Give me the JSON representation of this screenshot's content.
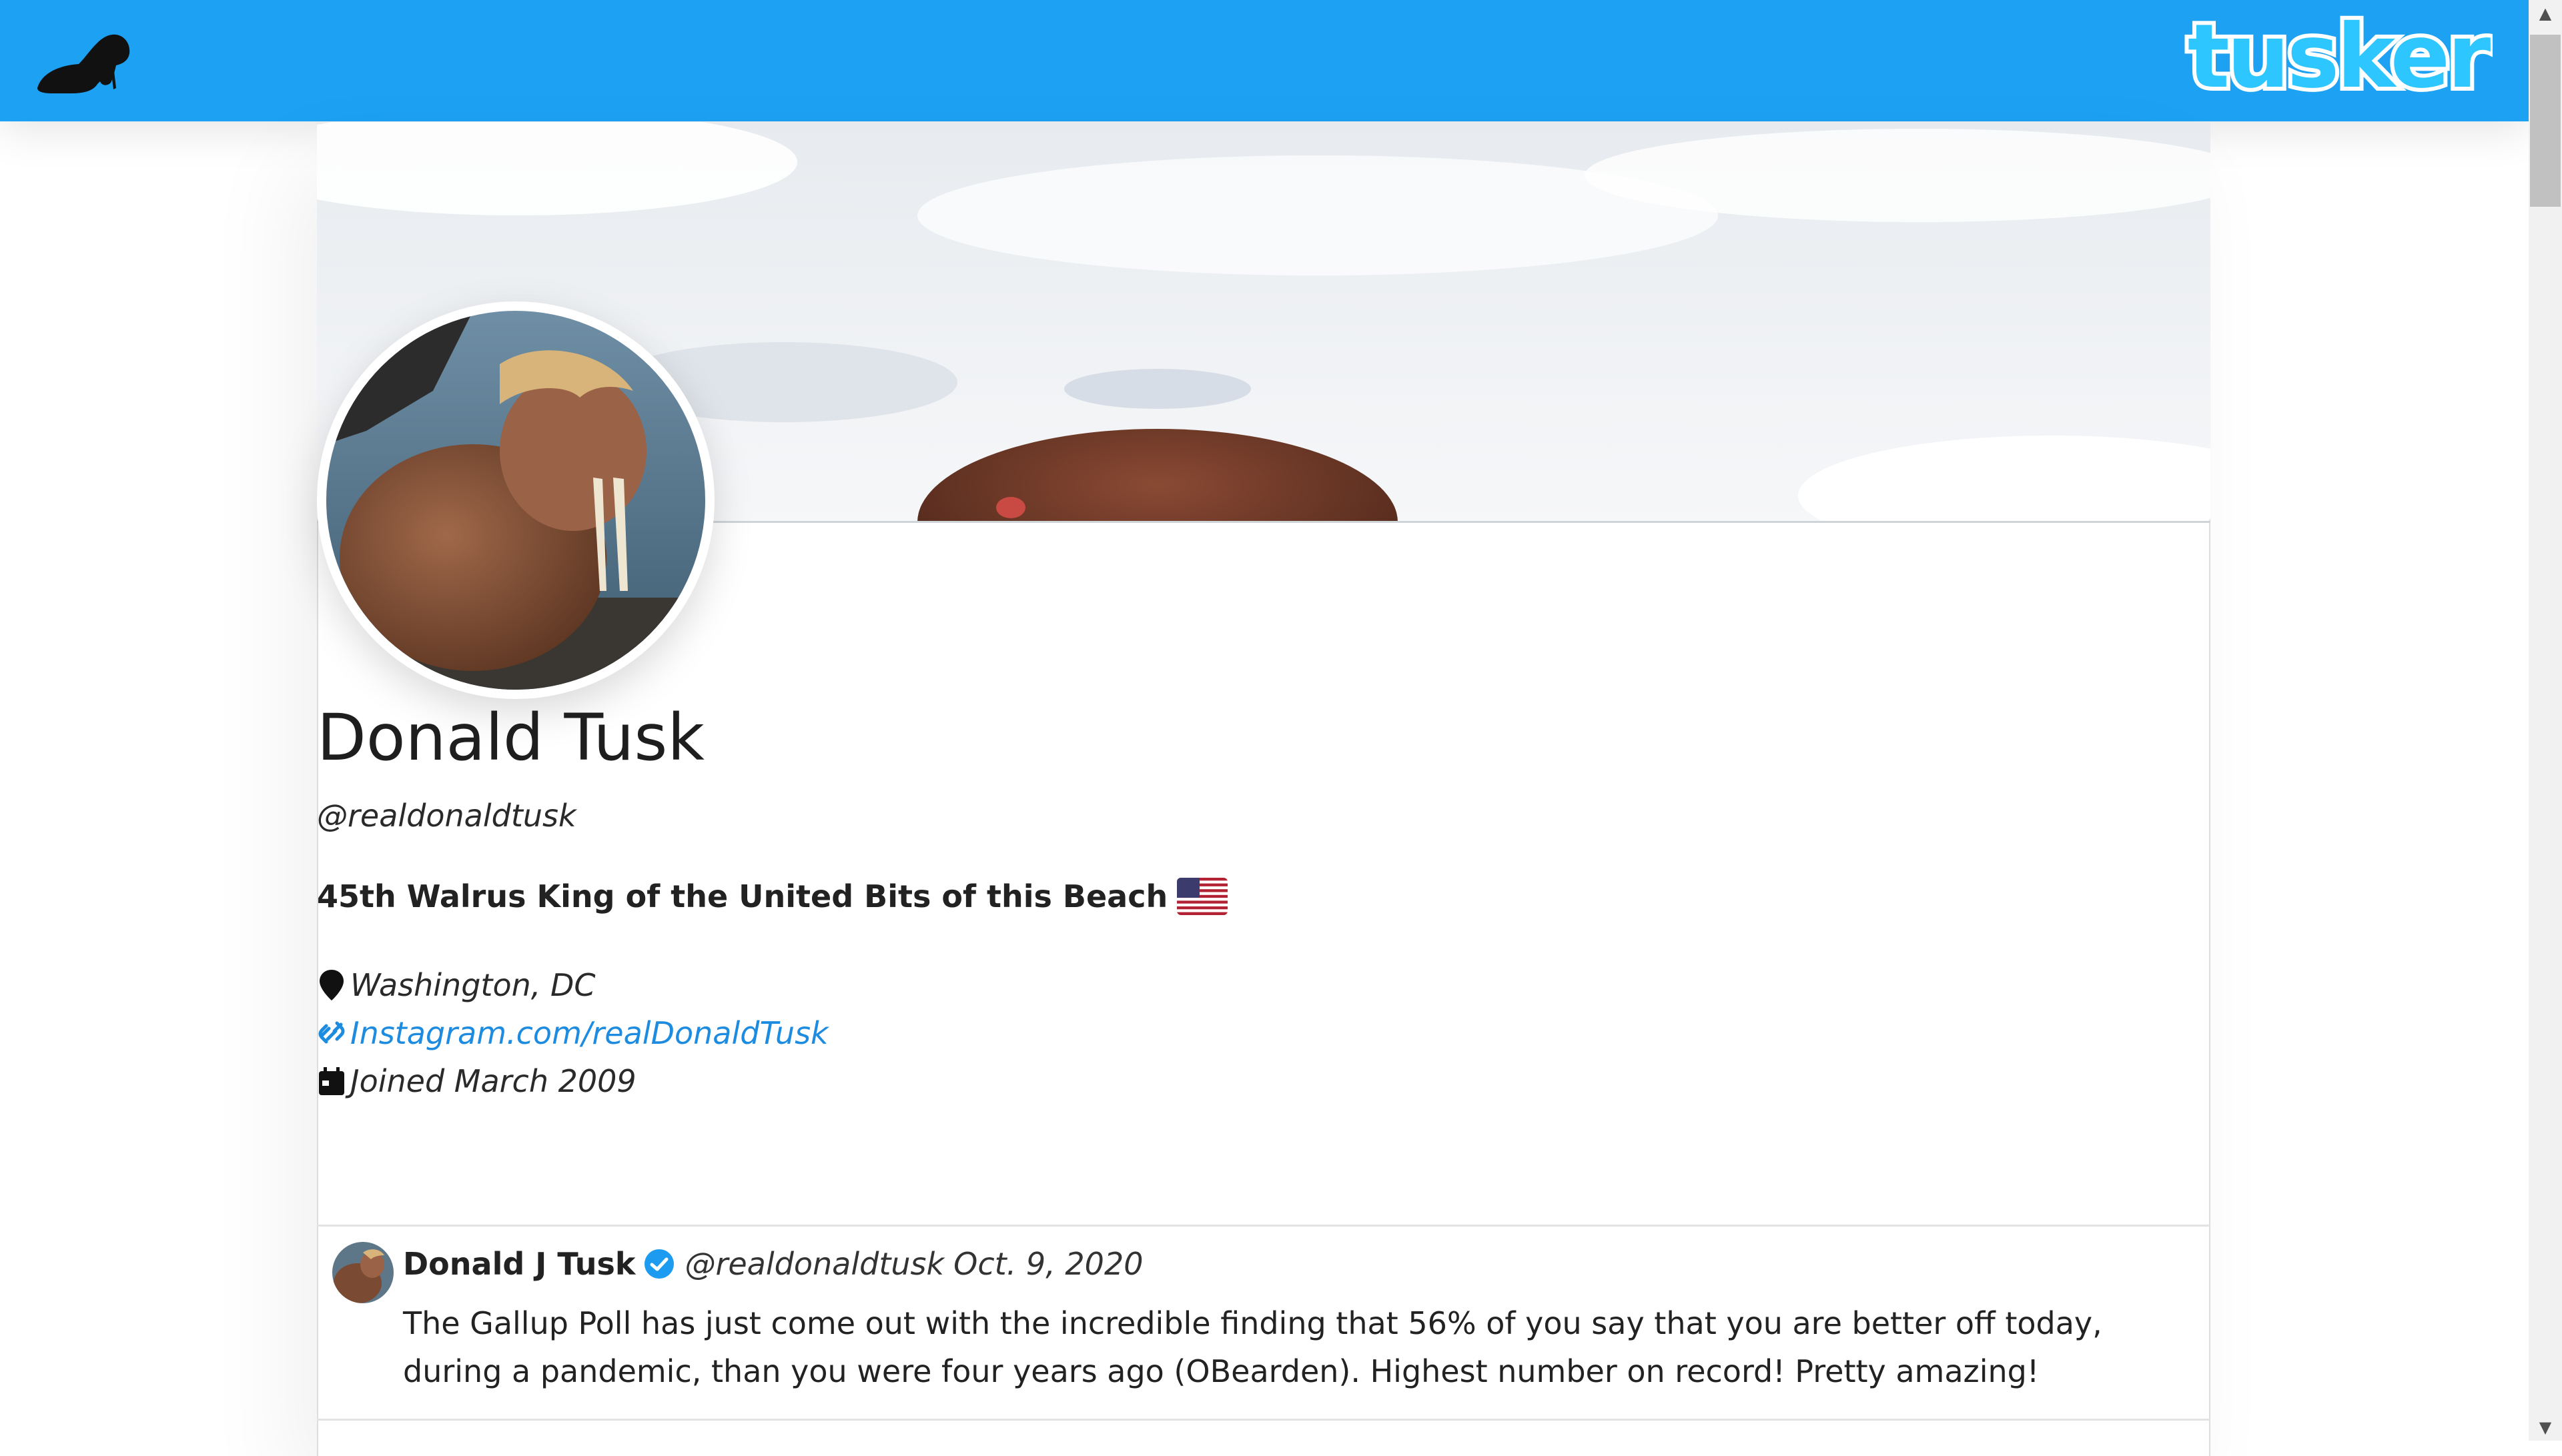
{
  "header": {
    "brand_wordmark": "tusker",
    "brand_color": "#1da1f2",
    "logo_icon": "walrus-silhouette-icon"
  },
  "profile": {
    "cover_image": "walrus-on-snow-cover",
    "avatar_image": "walrus-with-blond-hair-avatar",
    "display_name": "Donald Tusk",
    "handle": "@realdonaldtusk",
    "bio": "45th Walrus King of the United Bits of this Beach",
    "bio_icon": "us-flag-icon",
    "location": "Washington, DC",
    "website": "Instagram.com/realDonaldTusk",
    "joined": "Joined March 2009",
    "link_color": "#1d8ce0"
  },
  "tweets": [
    {
      "author": "Donald J Tusk",
      "verified_icon": "verified-badge-icon",
      "handle": "@realdonaldtusk",
      "date": "Oct. 9, 2020",
      "text": "The Gallup Poll has just come out with the incredible finding that 56% of you say that you are better off today, during a pandemic, than you were four years ago (OBearden). Highest number on record! Pretty amazing!"
    }
  ]
}
